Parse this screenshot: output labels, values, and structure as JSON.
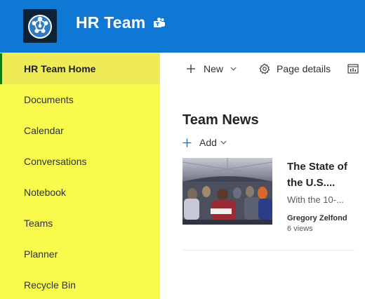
{
  "site": {
    "title": "HR Team",
    "header_color": "#0f78d4",
    "logo_icon": "network-people-logo",
    "teams_icon": "microsoft-teams-icon"
  },
  "sidebar": {
    "background": "#f9fb4c",
    "active_index": 0,
    "items": [
      {
        "label": "HR Team Home"
      },
      {
        "label": "Documents"
      },
      {
        "label": "Calendar"
      },
      {
        "label": "Conversations"
      },
      {
        "label": "Notebook"
      },
      {
        "label": "Teams"
      },
      {
        "label": "Planner"
      },
      {
        "label": "Recycle Bin"
      }
    ]
  },
  "command_bar": {
    "new_label": "New",
    "page_details_label": "Page details",
    "icons": [
      "plus-icon",
      "chevron-down-icon",
      "gear-icon",
      "analytics-icon"
    ]
  },
  "news": {
    "section_title": "Team News",
    "add_label": "Add",
    "items": [
      {
        "title": "The State of the U.S....",
        "description": "With the 10-...",
        "author": "Gregory Zelfond",
        "views": "6 views",
        "thumbnail_icon": "news-photo-thumbnail"
      }
    ]
  }
}
